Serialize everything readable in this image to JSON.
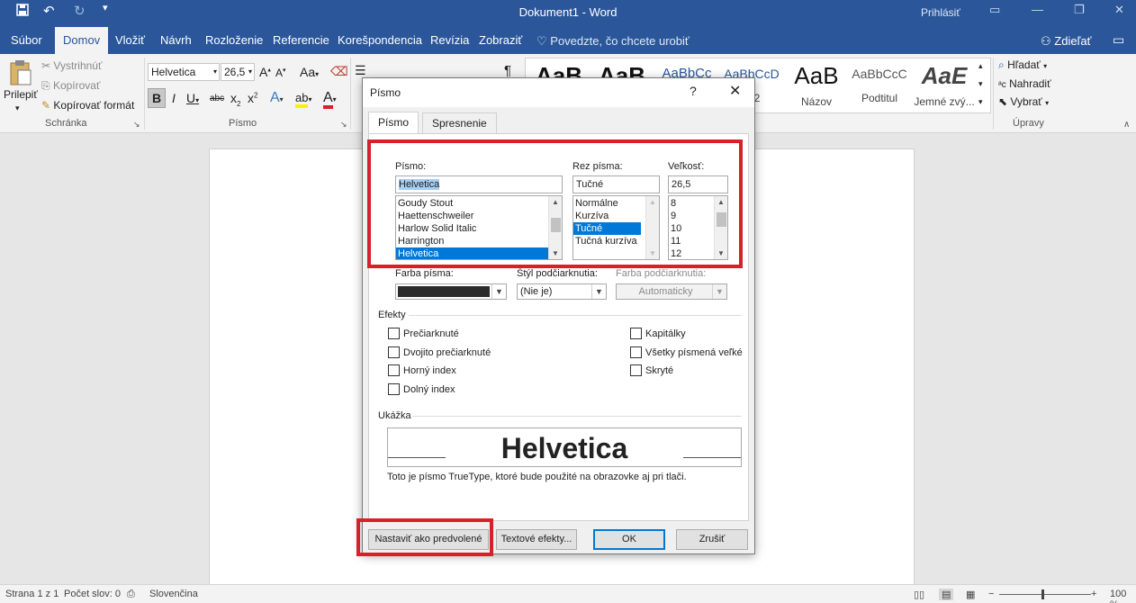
{
  "titlebar": {
    "title": "Dokument1  -  Word",
    "signin": "Prihlásiť",
    "icons": [
      "save-icon",
      "undo-icon",
      "redo-icon",
      "customize-qat-icon"
    ]
  },
  "tabs": [
    "Súbor",
    "Domov",
    "Vložiť",
    "Návrh",
    "Rozloženie",
    "Referencie",
    "Korešpondencia",
    "Revízia",
    "Zobraziť"
  ],
  "tellme": "Povedzte, čo chcete urobiť",
  "share": "Zdieľať",
  "ribbon": {
    "clipboard": {
      "paste": "Prilepiť",
      "cut": "Vystrihnúť",
      "copy": "Kopírovať",
      "format_painter": "Kopírovať formát",
      "group": "Schránka"
    },
    "font": {
      "name": "Helvetica",
      "size": "26,5",
      "group": "Písmo",
      "grow": "A",
      "shrink": "A",
      "case": "Aa",
      "bold": "B",
      "italic": "I",
      "underline": "U",
      "strike": "abc",
      "sub": "x",
      "sup": "x",
      "effects": "A",
      "highlight": "ab",
      "color": "A"
    },
    "paragraph": {
      "pilcrow": "¶"
    },
    "styles": [
      {
        "preview": "AaB",
        "name": ""
      },
      {
        "preview": "AaB",
        "name": ""
      },
      {
        "preview": "AaBbCc",
        "name": ""
      },
      {
        "preview": "AaBbCcD",
        "name": "is 2"
      },
      {
        "preview": "AaB",
        "name": "Názov"
      },
      {
        "preview": "AaBbCcC",
        "name": "Podtitul"
      },
      {
        "preview": "AaE",
        "name": "Jemné zvý..."
      }
    ],
    "editing": {
      "find": "Hľadať",
      "replace": "Nahradiť",
      "select": "Vybrať",
      "group": "Úpravy"
    }
  },
  "status": {
    "page": "Strana 1 z 1",
    "words": "Počet slov: 0",
    "language": "Slovenčina",
    "zoom": "100 %"
  },
  "dialog": {
    "title": "Písmo",
    "help": "?",
    "close": "✕",
    "tabs": [
      "Písmo",
      "Spresnenie"
    ],
    "font_label": "Písmo:",
    "font_value": "Helvetica",
    "font_list": [
      "Goudy Stout",
      "Haettenschweiler",
      "Harlow Solid Italic",
      "Harrington",
      "Helvetica"
    ],
    "style_label": "Rez písma:",
    "style_value": "Tučné",
    "style_list": [
      "Normálne",
      "Kurzíva",
      "Tučné",
      "Tučná kurzíva"
    ],
    "size_label": "Veľkosť:",
    "size_value": "26,5",
    "size_list": [
      "8",
      "9",
      "10",
      "11",
      "12"
    ],
    "color_label": "Farba písma:",
    "color_value": "#2b2b2b",
    "underline_label": "Štýl podčiarknutia:",
    "underline_value": "(Nie je)",
    "ucolor_label": "Farba podčiarknutia:",
    "ucolor_value": "Automaticky",
    "effects_label": "Efekty",
    "effects_left": [
      "Prečiarknuté",
      "Dvojito prečiarknuté",
      "Horný index",
      "Dolný index"
    ],
    "effects_right": [
      "Kapitálky",
      "Všetky písmená veľké",
      "Skryté"
    ],
    "preview_label": "Ukážka",
    "preview_text": "Helvetica",
    "preview_note": "Toto je písmo TrueType, ktoré bude použité na obrazovke aj pri tlači.",
    "buttons": {
      "default": "Nastaviť ako predvolené",
      "text_effects": "Textové efekty...",
      "ok": "OK",
      "cancel": "Zrušiť"
    }
  },
  "colors": {
    "accent": "#2b579a",
    "highlight": "#d9202a",
    "selection": "#0078d7"
  }
}
